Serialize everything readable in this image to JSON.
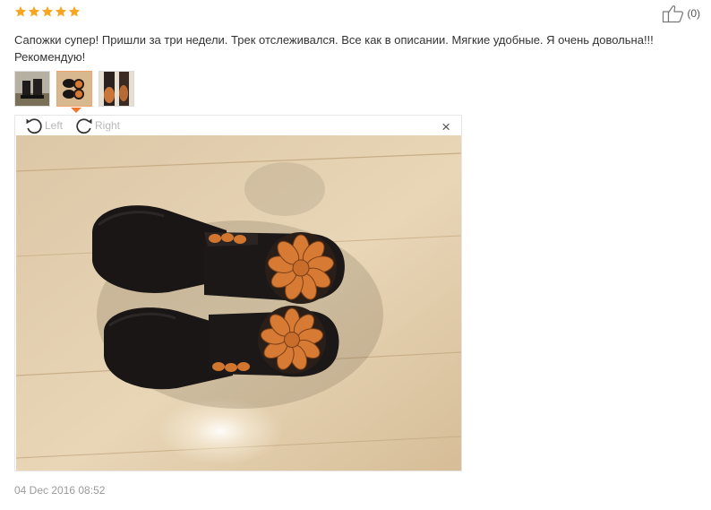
{
  "rating": {
    "stars": 5,
    "max": 5,
    "color": "#f6a623"
  },
  "helpful": {
    "icon": "thumbs-up-icon",
    "count_label": "(0)"
  },
  "review": {
    "text": "Сапожки супер! Пришли за три недели. Трек отслеживался. Все как в описании. Мягкие удобные. Я очень довольна!!! Рекомендую!"
  },
  "thumbnails": [
    {
      "name": "photo-thumbnail-1",
      "active": false
    },
    {
      "name": "photo-thumbnail-2",
      "active": true
    },
    {
      "name": "photo-thumbnail-3",
      "active": false
    }
  ],
  "viewer": {
    "rotate_left_label": "Left",
    "rotate_right_label": "Right",
    "close_label": "×",
    "image_alt": "boots photo"
  },
  "timestamp": "04 Dec 2016 08:52",
  "colors": {
    "accent": "#f0772c",
    "star": "#f6a623",
    "muted": "#9a9a9a"
  }
}
